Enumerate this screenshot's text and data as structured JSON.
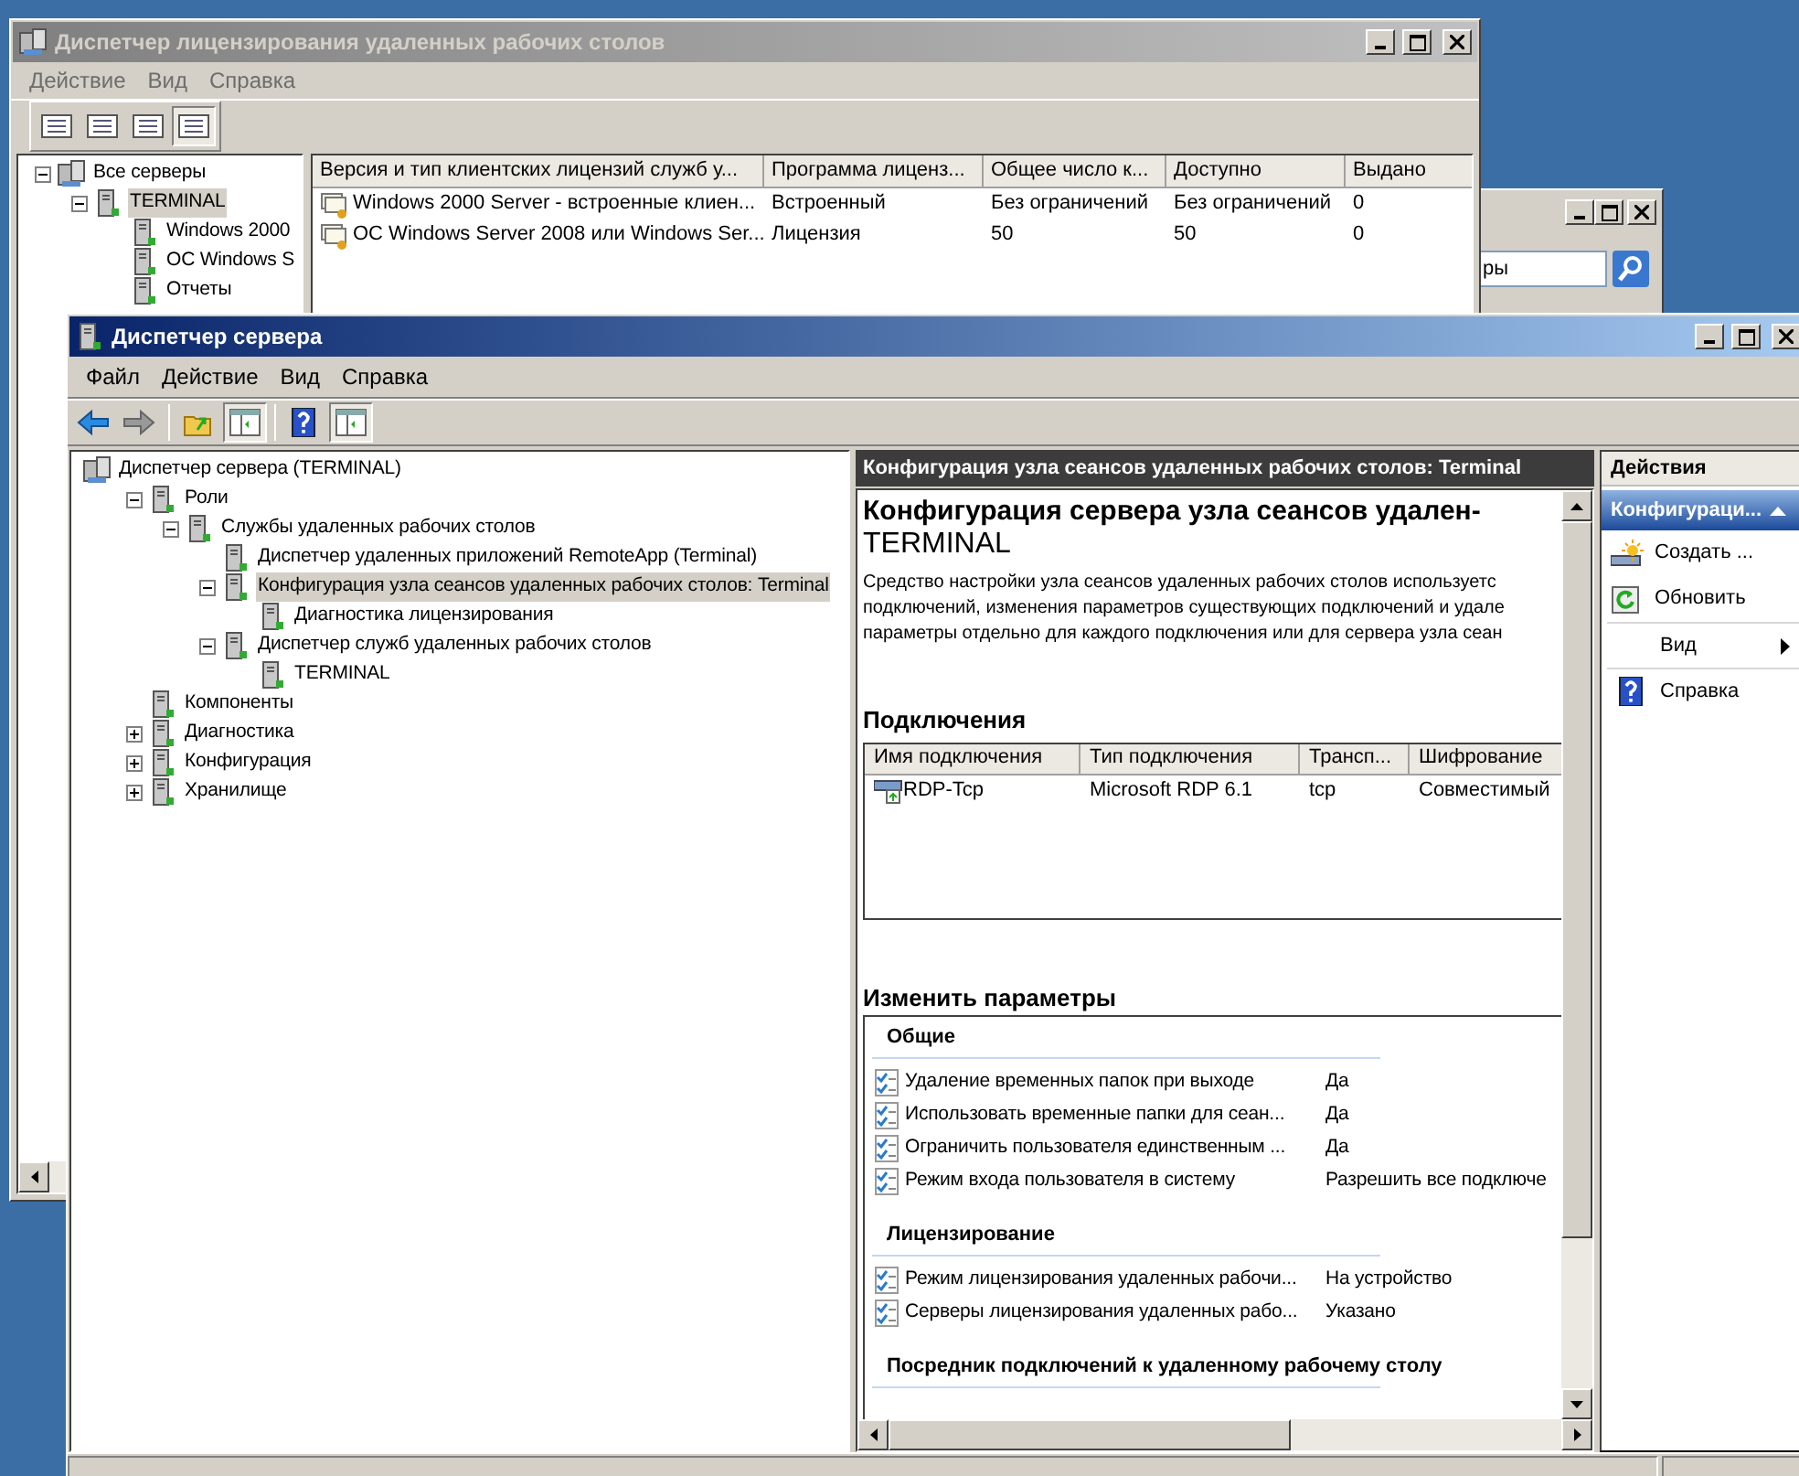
{
  "license_window": {
    "title": "Диспетчер лицензирования удаленных рабочих столов",
    "active": false,
    "menu": [
      {
        "label": "Действие"
      },
      {
        "label": "Вид"
      },
      {
        "label": "Справка"
      }
    ],
    "toolbar": [
      {
        "selected": false
      },
      {
        "selected": false
      },
      {
        "selected": false
      },
      {
        "selected": true
      }
    ],
    "tree": [
      {
        "label": "Все серверы",
        "expanded": true,
        "selected": false,
        "children": [
          {
            "label": "TERMINAL",
            "expanded": true,
            "selected": true,
            "children": [
              {
                "label": "Windows 2000",
                "selected": false
              },
              {
                "label": "ОС Windows S",
                "selected": false
              },
              {
                "label": "Отчеты",
                "selected": false
              }
            ]
          }
        ]
      }
    ],
    "table": {
      "columns": [
        "Версия и тип клиентских лицензий служб у...",
        "Программа лиценз...",
        "Общее число к...",
        "Доступно",
        "Выдано"
      ],
      "rows": [
        [
          "Windows 2000 Server - встроенные клиен...",
          "Встроенный",
          "Без ограничений",
          "Без ограничений",
          "0"
        ],
        [
          "ОС Windows Server 2008 или Windows Ser...",
          "Лицензия",
          "50",
          "50",
          "0"
        ]
      ]
    }
  },
  "search_window": {
    "search": {
      "value": "ры"
    }
  },
  "server_manager": {
    "title": "Диспетчер сервера",
    "active": true,
    "menu": [
      {
        "label": "Файл"
      },
      {
        "label": "Действие"
      },
      {
        "label": "Вид"
      },
      {
        "label": "Справка"
      }
    ],
    "toolbar": [
      {
        "selected": false
      },
      {
        "selected": false
      },
      {
        "selected": false
      },
      {
        "selected": true
      },
      {
        "selected": false
      },
      {
        "selected": true
      }
    ],
    "tree": [
      {
        "label": "Диспетчер сервера (TERMINAL)",
        "selected": false,
        "children": [
          {
            "label": "Роли",
            "expanded": true,
            "selected": false,
            "children": [
              {
                "label": "Службы удаленных рабочих столов",
                "expanded": true,
                "selected": false,
                "children": [
                  {
                    "label": "Диспетчер удаленных приложений RemoteApp (Terminal)",
                    "selected": false
                  },
                  {
                    "label": "Конфигурация узла сеансов удаленных рабочих столов: Terminal",
                    "expanded": true,
                    "selected": true,
                    "children": [
                      {
                        "label": "Диагностика лицензирования",
                        "selected": false
                      }
                    ]
                  },
                  {
                    "label": "Диспетчер служб удаленных рабочих столов",
                    "expanded": true,
                    "selected": false,
                    "children": [
                      {
                        "label": "TERMINAL",
                        "selected": false
                      }
                    ]
                  }
                ]
              }
            ]
          },
          {
            "label": "Компоненты",
            "selected": false
          },
          {
            "label": "Диагностика",
            "expanded": false,
            "selected": false
          },
          {
            "label": "Конфигурация",
            "expanded": false,
            "selected": false
          },
          {
            "label": "Хранилище",
            "expanded": false,
            "selected": false
          }
        ]
      }
    ],
    "center": {
      "header": "Конфигурация узла сеансов удаленных рабочих столов: Terminal",
      "title": "Конфигурация сервера узла сеансов удален-",
      "subtitle": "TERMINAL",
      "description": [
        "Средство настройки узла сеансов удаленных рабочих столов используетс",
        "подключений, изменения параметров существующих подключений и удале",
        "параметры отдельно для каждого подключения или для сервера узла сеан"
      ],
      "connections": {
        "heading": "Подключения",
        "columns": [
          "Имя подключения",
          "Тип подключения",
          "Трансп...",
          "Шифрование"
        ],
        "rows": [
          [
            "RDP-Tcp",
            "Microsoft RDP 6.1",
            "tcp",
            "Совместимый"
          ]
        ]
      },
      "settings": {
        "heading": "Изменить параметры",
        "groups": [
          {
            "title": "Общие",
            "rows": [
              [
                "Удаление временных папок при выходе",
                "Да"
              ],
              [
                "Использовать временные папки для сеан...",
                "Да"
              ],
              [
                "Ограничить пользователя единственным ...",
                "Да"
              ],
              [
                "Режим входа пользователя в систему",
                "Разрешить все подключе"
              ]
            ]
          },
          {
            "title": "Лицензирование",
            "rows": [
              [
                "Режим лицензирования удаленных рабочи...",
                "На устройство"
              ],
              [
                "Серверы лицензирования удаленных рабо...",
                "Указано"
              ]
            ]
          },
          {
            "title": "Посредник подключений к удаленному рабочему столу"
          }
        ]
      }
    },
    "actions": {
      "header": "Действия",
      "section": {
        "label": "Конфигураци...",
        "expanded": true
      },
      "items": [
        {
          "kind": "command",
          "label": "Создать ..."
        },
        {
          "kind": "command",
          "label": "Обновить"
        },
        {
          "kind": "submenu",
          "label": "Вид"
        },
        {
          "kind": "command",
          "label": "Справка"
        }
      ]
    }
  }
}
